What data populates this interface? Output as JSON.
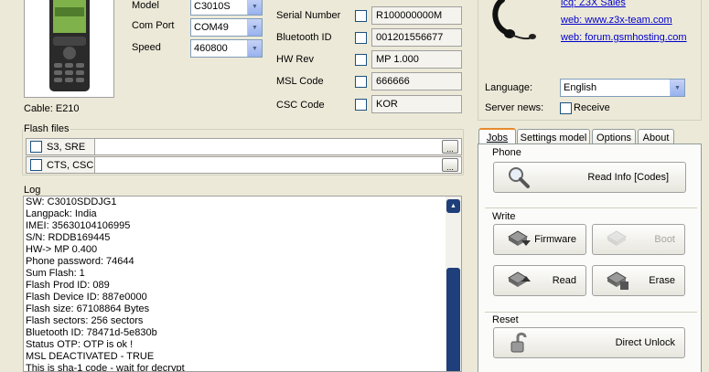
{
  "device": {
    "cable_label": "Cable: E210",
    "model_label": "Model",
    "model_value": "C3010S",
    "comport_label": "Com Port",
    "comport_value": "COM49",
    "speed_label": "Speed",
    "speed_value": "460800"
  },
  "info_fields": [
    {
      "label": "Serial Number",
      "value": "R100000000M"
    },
    {
      "label": "Bluetooth ID",
      "value": "001201556677"
    },
    {
      "label": "HW Rev",
      "value": "MP 1.000"
    },
    {
      "label": "MSL Code",
      "value": "666666"
    },
    {
      "label": "CSC Code",
      "value": "KOR"
    }
  ],
  "links": {
    "icq": "icq: Z3X Sales",
    "web1": "web: www.z3x-team.com",
    "web2": "web: forum.gsmhosting.com"
  },
  "language": {
    "label": "Language:",
    "value": "English"
  },
  "server_news": {
    "label": "Server news:",
    "checkbox_label": "Receive"
  },
  "flash_files": {
    "title": "Flash files",
    "rows": [
      {
        "name": "S3, SRE",
        "browse": "..."
      },
      {
        "name": "CTS, CSC",
        "browse": "..."
      }
    ]
  },
  "log": {
    "title": "Log",
    "lines": [
      "SW: C3010SDDJG1",
      "Langpack: India",
      "IMEI: 35630104106995",
      "S/N:  RDDB169445",
      "HW-> MP 0.400",
      "Phone password: 74644",
      "Sum Flash: 1",
      "Flash Prod ID: 089",
      "Flash Device ID: 887e0000",
      "Flash size: 67108864 Bytes",
      "Flash sectors: 256 sectors",
      "Bluetooth ID: 78471d-5e830b",
      "Status OTP: OTP is ok !",
      "MSL DEACTIVATED - TRUE",
      "This is sha-1 code - wait for decrypt"
    ]
  },
  "tabs": [
    "Jobs",
    "Settings model",
    "Options",
    "About"
  ],
  "jobs": {
    "phone_title": "Phone",
    "read_info": "Read Info [Codes]",
    "write_title": "Write",
    "firmware": "Firmware",
    "boot": "Boot",
    "read": "Read",
    "erase": "Erase",
    "reset_title": "Reset",
    "direct_unlock": "Direct Unlock"
  }
}
